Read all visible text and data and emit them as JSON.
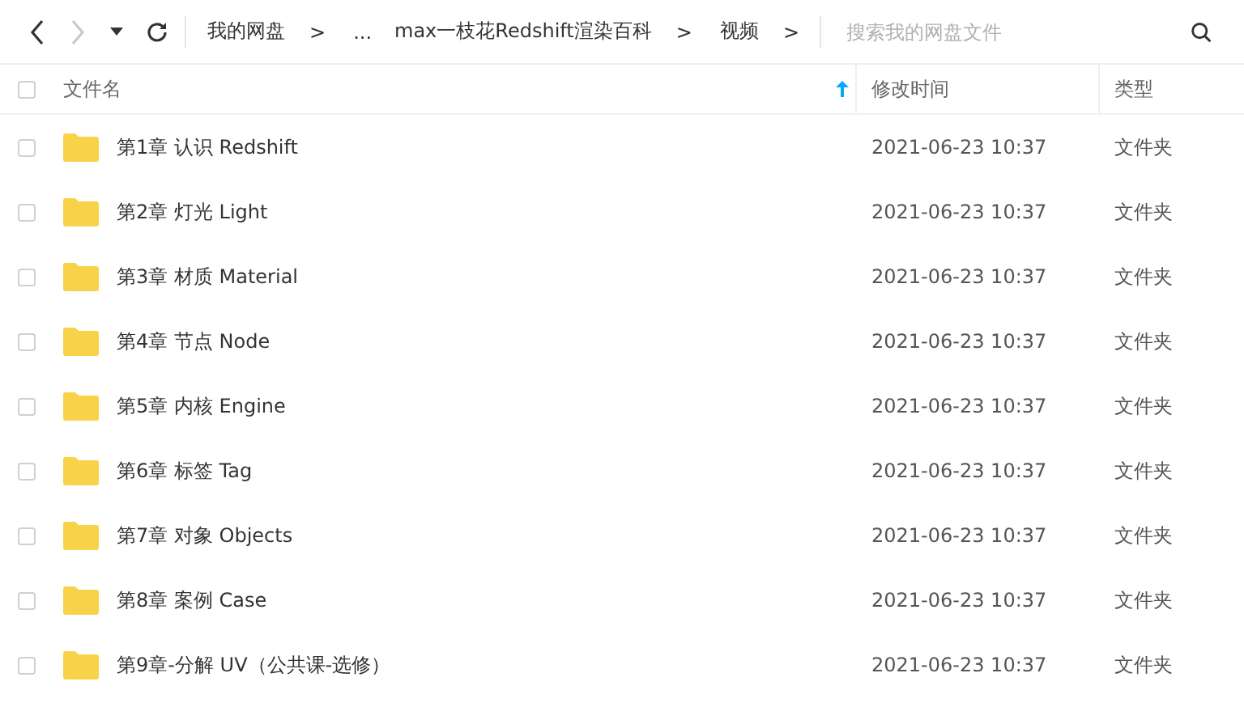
{
  "toolbar": {
    "nav": [
      {
        "kind": "back",
        "disabled": false
      },
      {
        "kind": "forward",
        "disabled": true
      },
      {
        "kind": "dropdown",
        "disabled": false
      },
      {
        "kind": "refresh",
        "disabled": false
      }
    ],
    "breadcrumb": [
      {
        "kind": "link",
        "text": "我的网盘"
      },
      {
        "kind": "sep",
        "text": ">"
      },
      {
        "kind": "link",
        "text": "..."
      },
      {
        "kind": "link",
        "text": "max一枝花Redshift渲染百科"
      },
      {
        "kind": "sep",
        "text": ">"
      },
      {
        "kind": "link",
        "text": "视频"
      },
      {
        "kind": "sep",
        "text": ">"
      }
    ],
    "search": {
      "placeholder": "搜索我的网盘文件"
    }
  },
  "table": {
    "select_all": {
      "checked": false
    },
    "columns": [
      {
        "label": "文件名",
        "sorted": true
      },
      {
        "label": "修改时间",
        "sorted": false
      },
      {
        "label": "类型",
        "sorted": false
      }
    ],
    "rows": [
      {
        "name": "第1章 认识 Redshift",
        "modified": "2021-06-23 10:37",
        "type": "文件夹",
        "checked": false
      },
      {
        "name": "第2章 灯光 Light",
        "modified": "2021-06-23 10:37",
        "type": "文件夹",
        "checked": false
      },
      {
        "name": "第3章 材质 Material",
        "modified": "2021-06-23 10:37",
        "type": "文件夹",
        "checked": false
      },
      {
        "name": "第4章 节点 Node",
        "modified": "2021-06-23 10:37",
        "type": "文件夹",
        "checked": false
      },
      {
        "name": "第5章 内核 Engine",
        "modified": "2021-06-23 10:37",
        "type": "文件夹",
        "checked": false
      },
      {
        "name": "第6章 标签 Tag",
        "modified": "2021-06-23 10:37",
        "type": "文件夹",
        "checked": false
      },
      {
        "name": "第7章 对象 Objects",
        "modified": "2021-06-23 10:37",
        "type": "文件夹",
        "checked": false
      },
      {
        "name": "第8章 案例 Case",
        "modified": "2021-06-23 10:37",
        "type": "文件夹",
        "checked": false
      },
      {
        "name": "第9章-分解 UV（公共课-选修）",
        "modified": "2021-06-23 10:37",
        "type": "文件夹",
        "checked": false
      }
    ]
  }
}
